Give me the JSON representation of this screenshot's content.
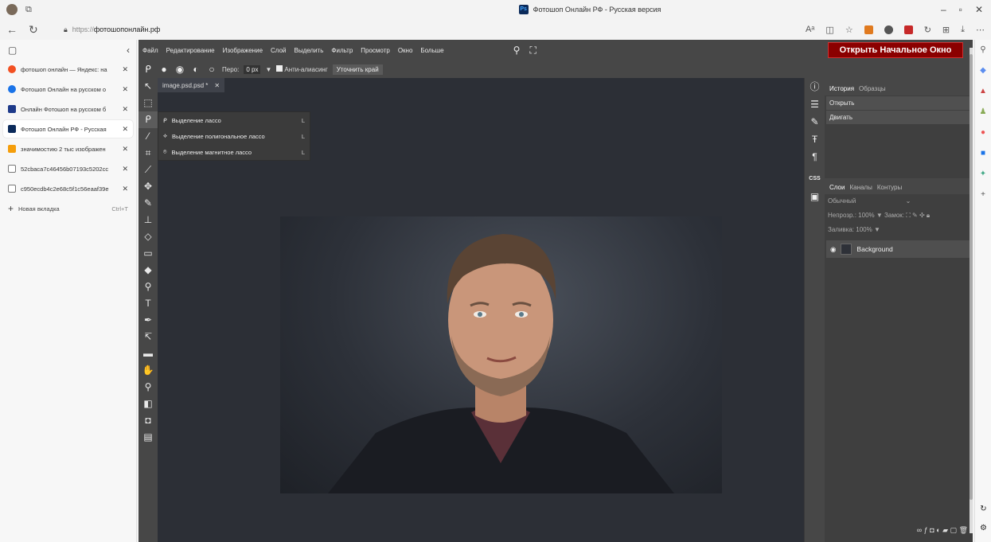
{
  "browser": {
    "window_title": "Фотошоп Онлайн РФ - Русская версия",
    "url_proto": "https://",
    "url_host": "фотошопонлайн.рф",
    "new_tab_label": "Новая вкладка",
    "new_tab_shortcut": "Ctrl+T",
    "tabs": [
      {
        "title": "фотошоп онлайн — Яндекс: на",
        "color": "#f25022"
      },
      {
        "title": "Фотошоп Онлайн на русском о",
        "color": "#1a73e8"
      },
      {
        "title": "Онлайн Фотошоп на русском б",
        "color": "#1e3a8a"
      },
      {
        "title": "Фотошоп Онлайн РФ - Русская",
        "color": "#0b2a5a"
      },
      {
        "title": "значимостию 2 тыс изображен",
        "color": "#f59e0b"
      },
      {
        "title": "52cbaca7c46456b07193c5202cc",
        "color": "#ffffff"
      },
      {
        "title": "c950ecdb4c2e68c5f1c56eaaf39e",
        "color": "#ffffff"
      }
    ]
  },
  "app": {
    "menu": [
      "Файл",
      "Редактирование",
      "Изображение",
      "Слой",
      "Выделить",
      "Фильтр",
      "Просмотр",
      "Окно",
      "Больше"
    ],
    "open_button": "Открыть Начальное Окно",
    "options": {
      "feather_label": "Перо:",
      "feather_value": "0 px",
      "antialias_label": "Анти-алиасинг",
      "refine_edge": "Уточнить край"
    },
    "document_tab": "image.psd.psd *",
    "lasso_flyout": [
      {
        "label": "Выделение лассо",
        "key": "L"
      },
      {
        "label": "Выделение полигональное лассо",
        "key": "L"
      },
      {
        "label": "Выделение магнитное лассо",
        "key": "L"
      }
    ],
    "history_panel": {
      "tabs": [
        "История",
        "Образцы"
      ],
      "items": [
        "Открыть",
        "Двигать"
      ]
    },
    "layers_panel": {
      "tabs": [
        "Слои",
        "Каналы",
        "Контуры"
      ],
      "blend_mode": "Обычный",
      "opacity_label": "Непрозр.:",
      "opacity_value": "100%",
      "lock_label": "Замок:",
      "fill_label": "Заливка:",
      "fill_value": "100%",
      "layers": [
        "Background"
      ]
    },
    "css_label": "CSS"
  }
}
